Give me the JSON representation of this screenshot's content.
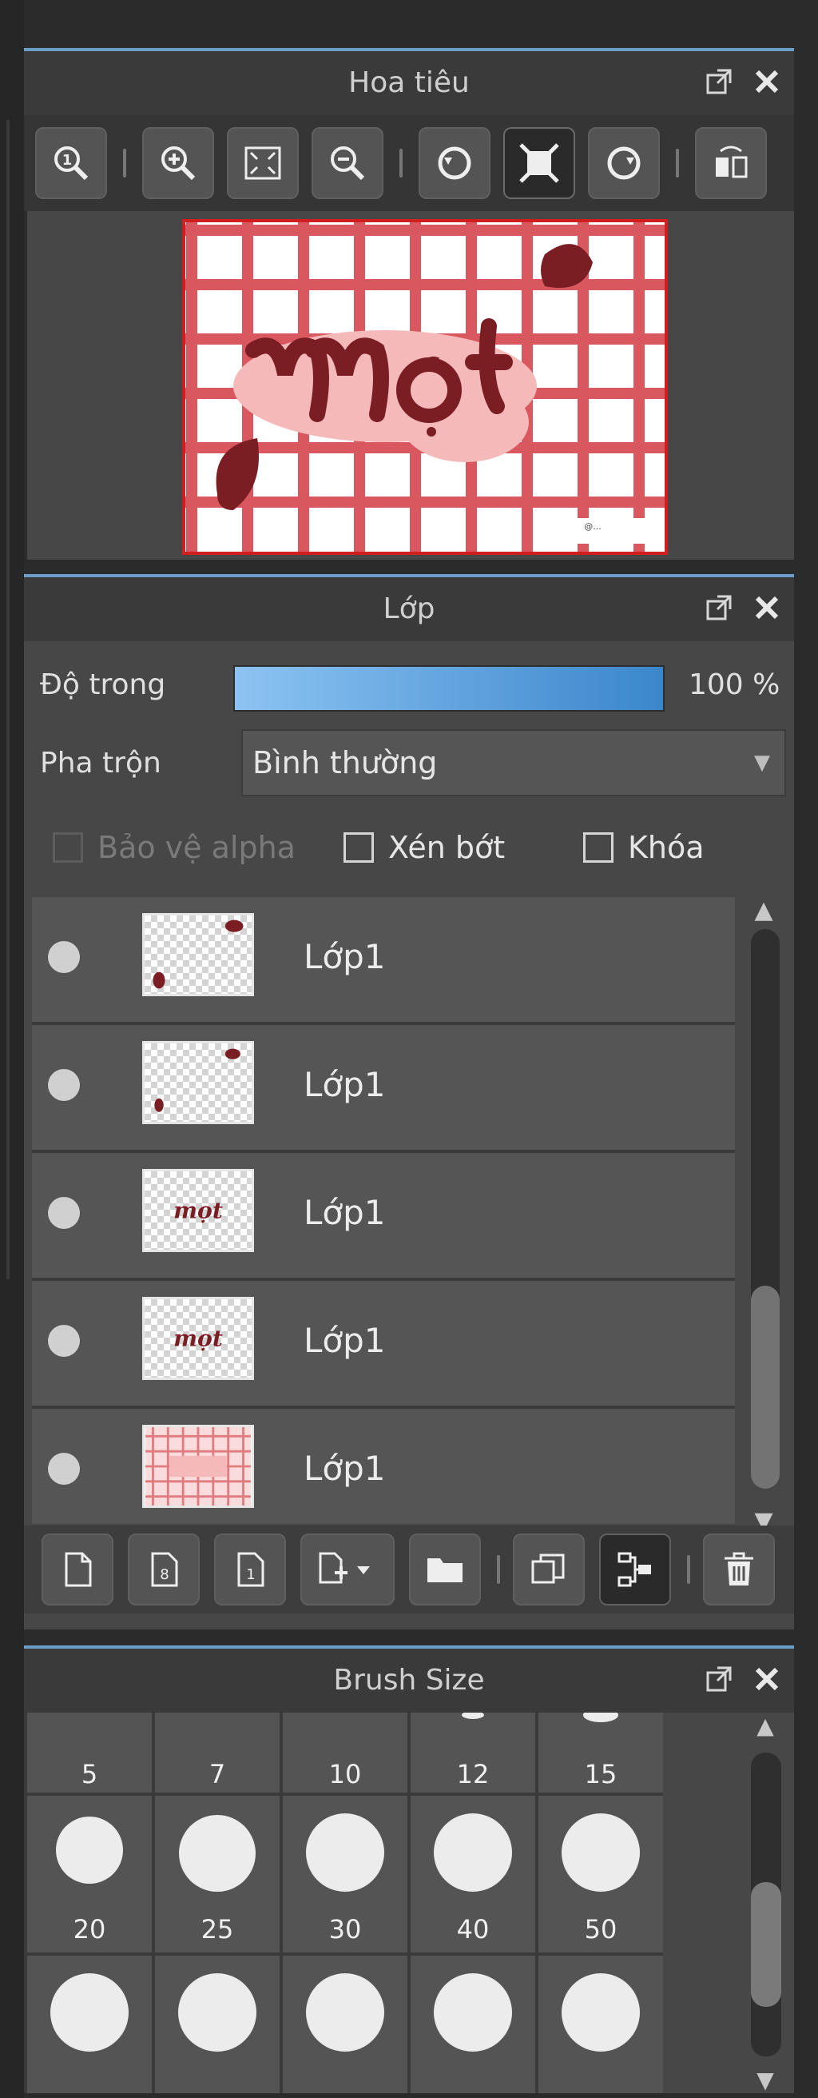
{
  "navigator": {
    "title": "Hoa tiêu",
    "toolbar_icons": [
      "zoom-actual-icon",
      "zoom-in-icon",
      "fit-screen-icon",
      "zoom-out-icon",
      "rotate-left-icon",
      "fit-canvas-icon",
      "rotate-right-icon",
      "flip-horizontal-icon"
    ],
    "preview_text": "mọt",
    "preview_caption": "@..."
  },
  "layers": {
    "title": "Lớp",
    "opacity_label": "Độ trong",
    "opacity_value": "100 %",
    "opacity_level": 1.0,
    "blend_label": "Pha trộn",
    "blend_value": "Bình thường",
    "protect_alpha": "Bảo vệ alpha",
    "clipping": "Xén bớt",
    "lock": "Khóa",
    "items": [
      {
        "name": "Lớp1",
        "thumb": "petals"
      },
      {
        "name": "Lớp1",
        "thumb": "petals-small"
      },
      {
        "name": "Lớp1",
        "thumb": "text"
      },
      {
        "name": "Lớp1",
        "thumb": "text"
      },
      {
        "name": "Lớp1",
        "thumb": "grid"
      }
    ]
  },
  "brush": {
    "title": "Brush Size",
    "row1_labels": [
      "5",
      "7",
      "10",
      "12",
      "15"
    ],
    "row2_labels": [
      "20",
      "25",
      "30",
      "40",
      "50"
    ]
  },
  "colors": {
    "accent": "#6b9ec9",
    "grid_red": "#d9575f",
    "dark_red": "#7a1e24",
    "pink": "#f6b9b9"
  }
}
